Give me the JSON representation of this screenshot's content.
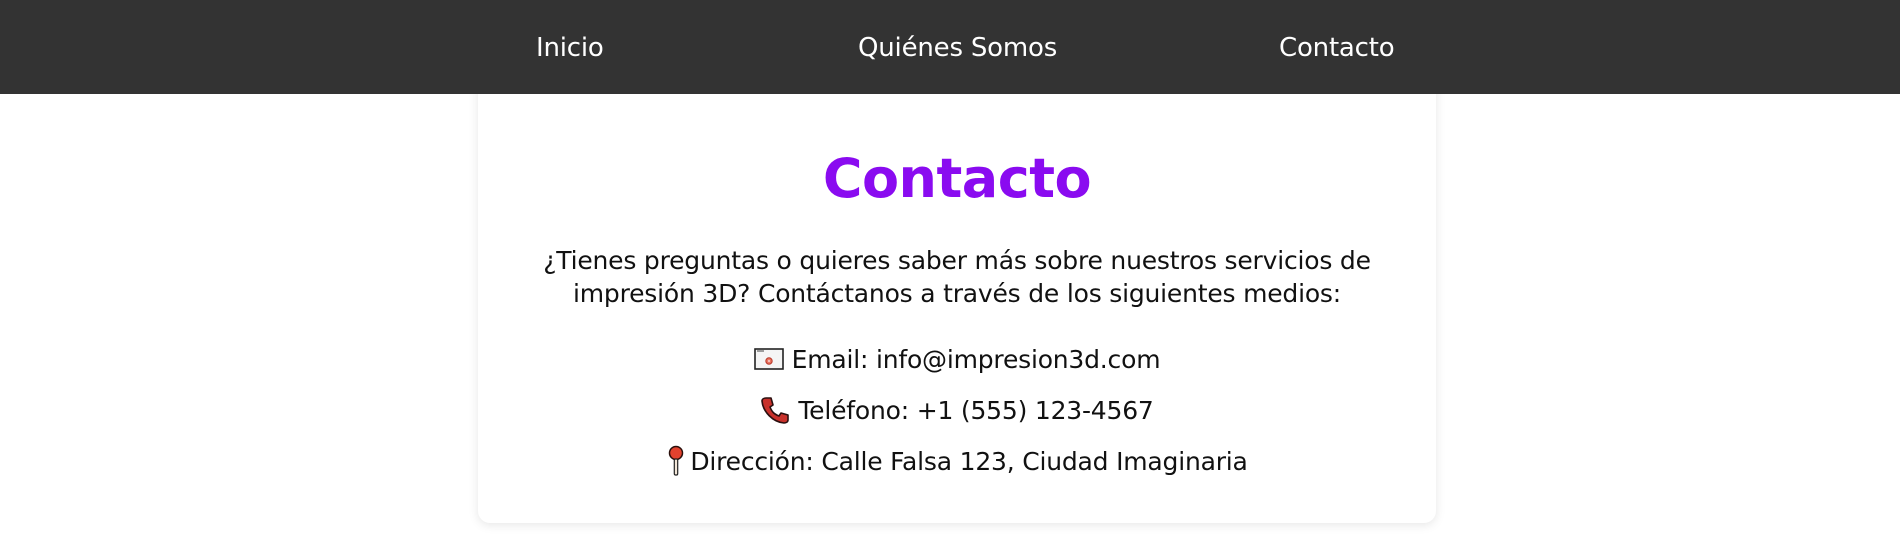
{
  "nav": {
    "items": [
      {
        "label": "Inicio"
      },
      {
        "label": "Quiénes Somos"
      },
      {
        "label": "Contacto"
      }
    ]
  },
  "contact": {
    "title": "Contacto",
    "intro": "¿Tienes preguntas o quieres saber más sobre nuestros servicios de impresión 3D? Contáctanos a través de los siguientes medios:",
    "email_text": "Email: info@impresion3d.com",
    "phone_text": "Teléfono: +1 (555) 123-4567",
    "address_text": "Dirección: Calle Falsa 123, Ciudad Imaginaria",
    "icons": {
      "email": "envelope-icon",
      "phone": "telephone-icon",
      "address": "pin-icon"
    }
  },
  "colors": {
    "nav_background": "#333333",
    "nav_text": "#ffffff",
    "title": "#8a0bf0",
    "body_text": "#111111",
    "card_background": "#ffffff"
  }
}
